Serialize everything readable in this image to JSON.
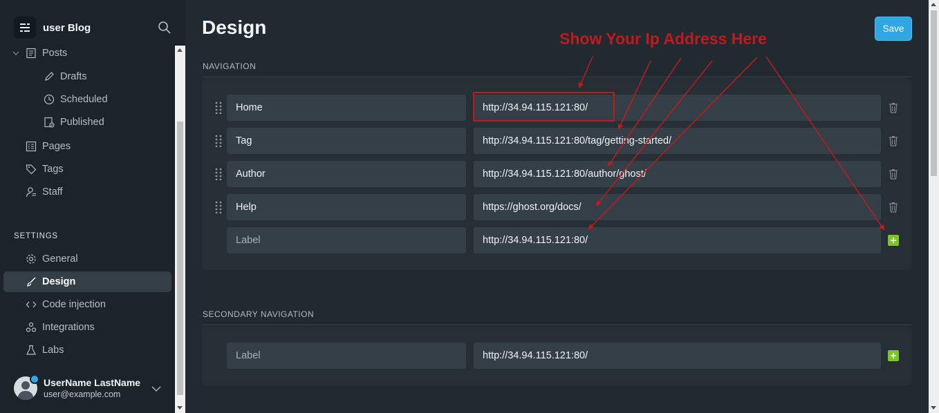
{
  "app": {
    "brand_name": "user Blog"
  },
  "sidebar": {
    "items": [
      {
        "label": "Posts",
        "icon": "posts-icon"
      },
      {
        "label": "Drafts",
        "icon": "pencil-icon"
      },
      {
        "label": "Scheduled",
        "icon": "clock-icon"
      },
      {
        "label": "Published",
        "icon": "published-icon"
      },
      {
        "label": "Pages",
        "icon": "pages-icon"
      },
      {
        "label": "Tags",
        "icon": "tag-icon"
      },
      {
        "label": "Staff",
        "icon": "staff-icon"
      }
    ],
    "settings_heading": "SETTINGS",
    "settings_items": [
      {
        "label": "General",
        "icon": "gear-icon"
      },
      {
        "label": "Design",
        "icon": "brush-icon",
        "active": true
      },
      {
        "label": "Code injection",
        "icon": "code-icon"
      },
      {
        "label": "Integrations",
        "icon": "integrations-icon"
      },
      {
        "label": "Labs",
        "icon": "flask-icon"
      }
    ],
    "user": {
      "name": "UserName LastName",
      "email": "user@example.com"
    }
  },
  "header": {
    "title": "Design",
    "save_label": "Save"
  },
  "navigation": {
    "heading": "NAVIGATION",
    "items": [
      {
        "label": "Home",
        "url": "http://34.94.115.121:80/"
      },
      {
        "label": "Tag",
        "url": "http://34.94.115.121:80/tag/getting-started/"
      },
      {
        "label": "Author",
        "url": "http://34.94.115.121:80/author/ghost/"
      },
      {
        "label": "Help",
        "url": "https://ghost.org/docs/"
      }
    ],
    "new_item": {
      "label_placeholder": "Label",
      "url": "http://34.94.115.121:80/"
    }
  },
  "secondary_navigation": {
    "heading": "SECONDARY NAVIGATION",
    "new_item": {
      "label_placeholder": "Label",
      "url": "http://34.94.115.121:80/"
    }
  },
  "annotation": {
    "text": "Show Your Ip Address Here",
    "color": "#c2191c"
  },
  "colors": {
    "accent": "#30a7e3",
    "add": "#7fc32b"
  }
}
